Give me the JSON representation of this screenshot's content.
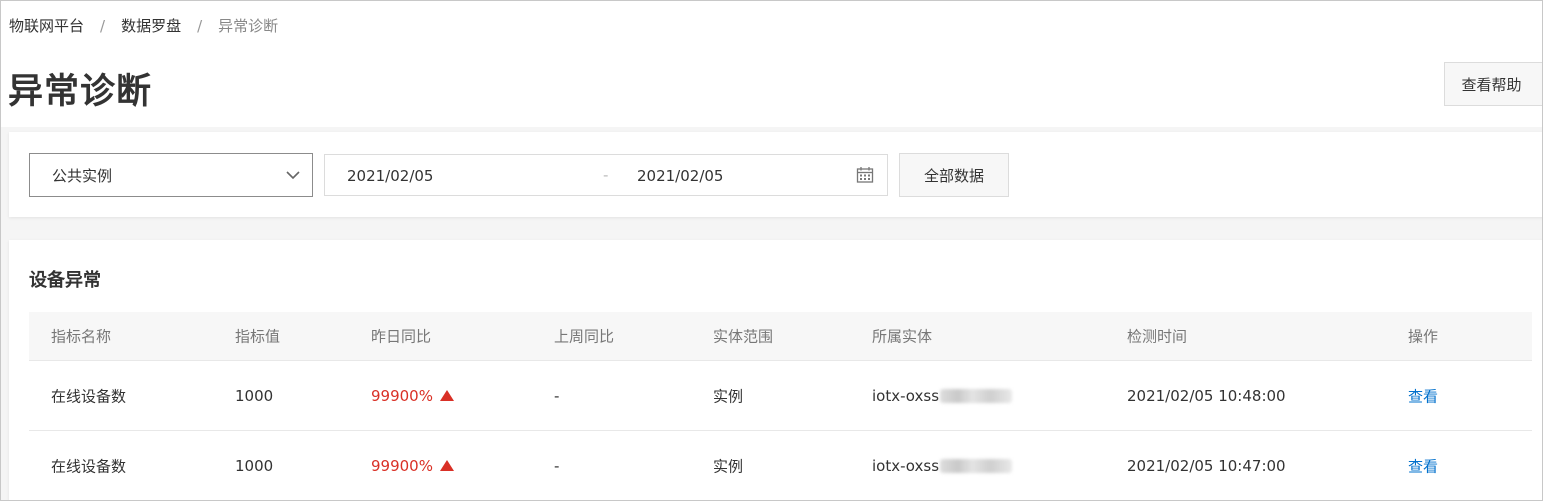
{
  "breadcrumb": {
    "items": [
      "物联网平台",
      "数据罗盘"
    ],
    "separator": "/",
    "current": "异常诊断"
  },
  "page": {
    "title": "异常诊断",
    "help_label": "查看帮助"
  },
  "filters": {
    "instance_value": "公共实例",
    "date_start": "2021/02/05",
    "date_separator": "-",
    "date_end": "2021/02/05",
    "all_data_label": "全部数据"
  },
  "table_section": {
    "title": "设备异常",
    "columns": [
      "指标名称",
      "指标值",
      "昨日同比",
      "上周同比",
      "实体范围",
      "所属实体",
      "检测时间",
      "操作"
    ],
    "rows": [
      {
        "name": "在线设备数",
        "value": "1000",
        "yesterday": "99900%",
        "last_week": "-",
        "scope": "实例",
        "entity": "iotx-oxss",
        "time": "2021/02/05 10:48:00",
        "action": "查看"
      },
      {
        "name": "在线设备数",
        "value": "1000",
        "yesterday": "99900%",
        "last_week": "-",
        "scope": "实例",
        "entity": "iotx-oxss",
        "time": "2021/02/05 10:47:00",
        "action": "查看"
      }
    ]
  },
  "colors": {
    "accent_link": "#0070cc",
    "increase_red": "#d93026"
  },
  "icons": [
    "chevron-down-icon",
    "calendar-icon",
    "arrow-up-icon"
  ]
}
